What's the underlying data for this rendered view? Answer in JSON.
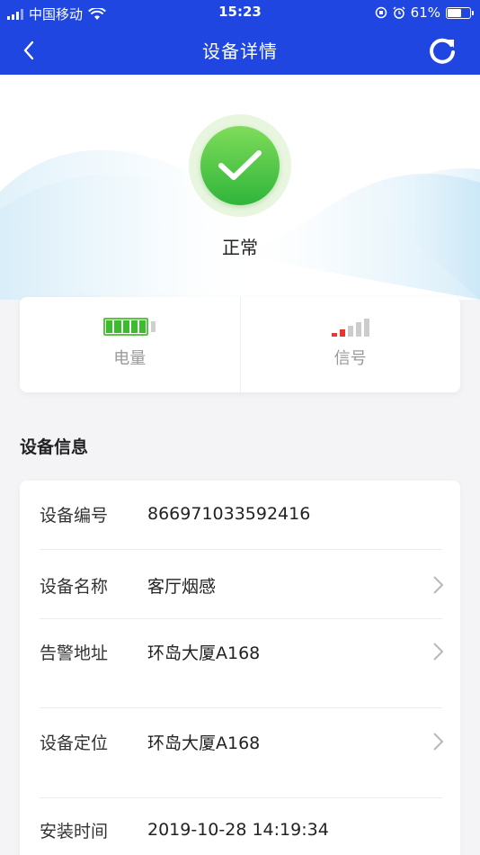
{
  "status_bar": {
    "carrier": "中国移动",
    "time": "15:23",
    "battery_percent": "61%",
    "battery_level": 0.61
  },
  "nav": {
    "title": "设备详情",
    "back_icon": "chevron-left-icon",
    "refresh_icon": "refresh-icon"
  },
  "status": {
    "text": "正常",
    "icon": "check-icon",
    "color": "#3dbb2e"
  },
  "indicators": {
    "battery_label": "电量",
    "signal_label": "信号",
    "battery_segments_filled": 5,
    "battery_segments_total": 5,
    "signal_bars_filled": 2,
    "signal_bars_total": 5
  },
  "section": {
    "title": "设备信息"
  },
  "info": [
    {
      "label": "设备编号",
      "value": "866971033592416",
      "has_chevron": false
    },
    {
      "label": "设备名称",
      "value": "客厅烟感",
      "has_chevron": true
    },
    {
      "label": "告警地址",
      "value": "环岛大厦A168",
      "has_chevron": true
    },
    {
      "label": "设备定位",
      "value": "环岛大厦A168",
      "has_chevron": true
    },
    {
      "label": "安装时间",
      "value": "2019-10-28 14:19:34",
      "has_chevron": false
    }
  ],
  "colors": {
    "primary": "#1f46e0",
    "success": "#3dbb2e",
    "signal_active": "#e8372e",
    "signal_inactive": "#cccccc"
  }
}
